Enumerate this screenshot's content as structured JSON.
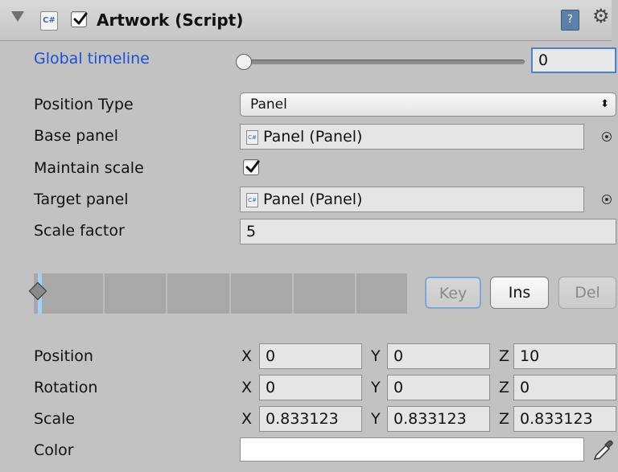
{
  "header": {
    "title": "Artwork (Script)",
    "enabled": true,
    "script_icon": "C#"
  },
  "global_timeline": {
    "label": "Global timeline",
    "value": "0",
    "slider_fraction": 0
  },
  "position_type": {
    "label": "Position Type",
    "value": "Panel"
  },
  "base_panel": {
    "label": "Base panel",
    "value": "Panel (Panel)"
  },
  "maintain_scale": {
    "label": "Maintain scale",
    "checked": true
  },
  "target_panel": {
    "label": "Target panel",
    "value": "Panel (Panel)"
  },
  "scale_factor": {
    "label": "Scale factor",
    "value": "5"
  },
  "keyframe_buttons": {
    "key": "Key",
    "ins": "Ins",
    "del": "Del"
  },
  "transform": {
    "axis_x": "X",
    "axis_y": "Y",
    "axis_z": "Z",
    "position": {
      "label": "Position",
      "x": "0",
      "y": "0",
      "z": "10"
    },
    "rotation": {
      "label": "Rotation",
      "x": "0",
      "y": "0",
      "z": "0"
    },
    "scale": {
      "label": "Scale",
      "x": "0.833123",
      "y": "0.833123",
      "z": "0.833123"
    }
  },
  "color": {
    "label": "Color",
    "value": "#ffffff"
  },
  "icons": {
    "foldout": "triangle-down-icon",
    "book": "help-book-icon",
    "gear": "gear-icon",
    "picker": "object-picker-icon",
    "eyedropper": "eyedropper-icon"
  },
  "colors": {
    "accent": "#1b4fd8",
    "focus": "#4a83c9",
    "background": "#c2c2c2"
  }
}
